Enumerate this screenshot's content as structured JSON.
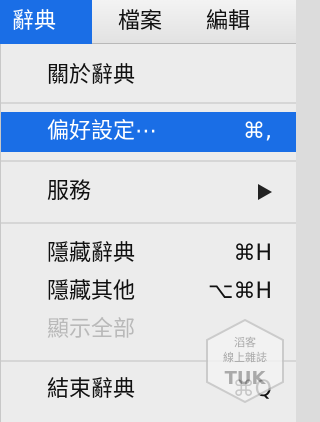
{
  "menubar": {
    "items": [
      {
        "label": "辭典",
        "active": true
      },
      {
        "label": "檔案",
        "active": false
      },
      {
        "label": "編輯",
        "active": false
      }
    ]
  },
  "menu": {
    "about": {
      "label": "關於辭典"
    },
    "preferences": {
      "label": "偏好設定⋯",
      "shortcut": "⌘,"
    },
    "services": {
      "label": "服務",
      "has_submenu": true,
      "submenu_icon": "triangle-right-icon"
    },
    "hide_app": {
      "label": "隱藏辭典",
      "shortcut": "⌘H"
    },
    "hide_others": {
      "label": "隱藏其他",
      "shortcut": "⌥⌘H"
    },
    "show_all": {
      "label": "顯示全部",
      "disabled": true
    },
    "quit": {
      "label": "結束辭典",
      "shortcut": "⌘Q"
    }
  },
  "watermark": {
    "line1": "滔客",
    "line2": "線上雜誌",
    "line3": "TUK"
  },
  "colors": {
    "highlight": "#1a6ee6",
    "menu_bg": "#ececec",
    "disabled_text": "#b9b9b9"
  }
}
